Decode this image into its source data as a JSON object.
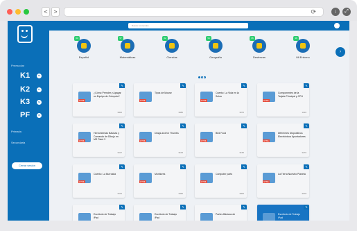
{
  "window": {
    "dots": [
      "#ff5f57",
      "#febc2e",
      "#28c840"
    ],
    "nav": [
      "<",
      ">"
    ]
  },
  "topbar": {
    "search_placeholder": "Buscar contenidos"
  },
  "sidebar": {
    "section_label": "Preescolar",
    "grades": [
      {
        "label": "K1",
        "badge": "60"
      },
      {
        "label": "K2",
        "badge": "57"
      },
      {
        "label": "K3",
        "badge": "62"
      },
      {
        "label": "PF",
        "badge": "95"
      }
    ],
    "rows": [
      {
        "label": "Primaria"
      },
      {
        "label": "Secundaria"
      }
    ],
    "button": "Cerrar sesión"
  },
  "subjects": [
    {
      "label": "Español",
      "badge": "60"
    },
    {
      "label": "Matemáticas",
      "badge": "57"
    },
    {
      "label": "Ciencias",
      "badge": "62"
    },
    {
      "label": "Geografía",
      "badge": "54"
    },
    {
      "label": "Destrezas",
      "badge": "95"
    },
    {
      "label": "Mi Entorno",
      "badge": "38"
    }
  ],
  "cards": [
    {
      "title": "¿Cómo Prender y Apagar un Equipo de Cómputo?",
      "code": "3000",
      "active": false
    },
    {
      "title": "Tipos de Mouse",
      "code": "3080",
      "active": false
    },
    {
      "title": "Cuento: La Vida en la Selva",
      "code": "3076",
      "active": false
    },
    {
      "title": "Componentes de la Tarjeta Principal y CPU",
      "code": "1120",
      "active": false
    },
    {
      "title": "Herramientas Básicas y Comando de Dibujo en MS Paint 3",
      "code": "3317",
      "active": false
    },
    {
      "title": "Drags and for Thumbs",
      "code": "3105",
      "active": false
    },
    {
      "title": "Bird Food",
      "code": "3156",
      "active": false
    },
    {
      "title": "Diferentes Dispositivos Electrónicos Apuntadores",
      "code": "3270",
      "active": false
    },
    {
      "title": "Cuento: La Burrosita",
      "code": "3370",
      "active": false
    },
    {
      "title": "Monitores",
      "code": "3360",
      "active": false
    },
    {
      "title": "Computer parts",
      "code": "3000",
      "active": false
    },
    {
      "title": "La Tierra Nuestro Planeta",
      "code": "3078",
      "active": false
    },
    {
      "title": "Escritorio de Trabajo iPad",
      "code": "",
      "active": false
    },
    {
      "title": "Escritorio de Trabajo iPad",
      "code": "",
      "active": false
    },
    {
      "title": "Partes Básicas de",
      "code": "",
      "active": false
    },
    {
      "title": "Escritorio de Trabajo iPad",
      "code": "",
      "active": true
    }
  ]
}
